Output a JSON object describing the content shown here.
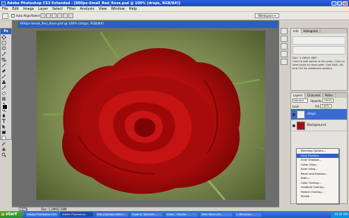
{
  "window": {
    "title": "Adobe Photoshop CS3 Extended - [800px-Small_Red_Rose.psd @ 100% (drops, RGB/8#)]",
    "buttons": [
      "minimize",
      "maximize",
      "close"
    ]
  },
  "menubar": {
    "items": [
      "File",
      "Edit",
      "Image",
      "Layer",
      "Select",
      "Filter",
      "Analysis",
      "View",
      "Window",
      "Help"
    ]
  },
  "options_bar": {
    "auto_align_label": "Auto Align/Select",
    "workspace_label": "Workspace ▾"
  },
  "toolbox": {
    "logo": "Ps"
  },
  "document": {
    "title": "800px-Small_Red_Rose.psd @ 100% (drops, RGB/8#)",
    "zoom": "100%",
    "doc_info": "Doc: 1.29M/2.58M",
    "colors": {
      "rose": "#b30d0d",
      "rose_dark": "#6e0404",
      "leaf": "#6f8a3a",
      "bg": "#8a9460"
    }
  },
  "info_panel": {
    "tabs": [
      "Info",
      "Histogram"
    ],
    "status_text": "Doc: 1.29M/2.58M",
    "help_text": "Click to add points to the path. Click on start point to close path. Use Shift, Alt, and Ctrl for additional options."
  },
  "layers_panel": {
    "tabs": [
      "Layers",
      "Channels",
      "Paths"
    ],
    "blend_mode": "Normal",
    "opacity_label": "Opacity:",
    "opacity_value": "100%",
    "lock_label": "Lock:",
    "fill_label": "Fill:",
    "fill_value": "100%",
    "layers": [
      {
        "name": "drops",
        "selected": true
      },
      {
        "name": "Background",
        "selected": false
      }
    ]
  },
  "context_menu": {
    "items": [
      "Blending Options...",
      "Drop Shadow...",
      "Inner Shadow...",
      "Outer Glow...",
      "Inner Glow...",
      "Bevel and Emboss...",
      "Satin...",
      "Color Overlay...",
      "Gradient Overlay...",
      "Pattern Overlay...",
      "Stroke..."
    ],
    "highlighted_index": 1
  },
  "taskbar": {
    "start_label": "start",
    "tasks": [
      "Adobe Photoshop CS3",
      "Adobe Photoshop...",
      "http://upload.wikim...",
      "Organic Tutorials...",
      "Inbox - Mozilla...",
      "New Inbox (D:)",
      "2 Windows..."
    ],
    "clock": "10:32 AM"
  }
}
